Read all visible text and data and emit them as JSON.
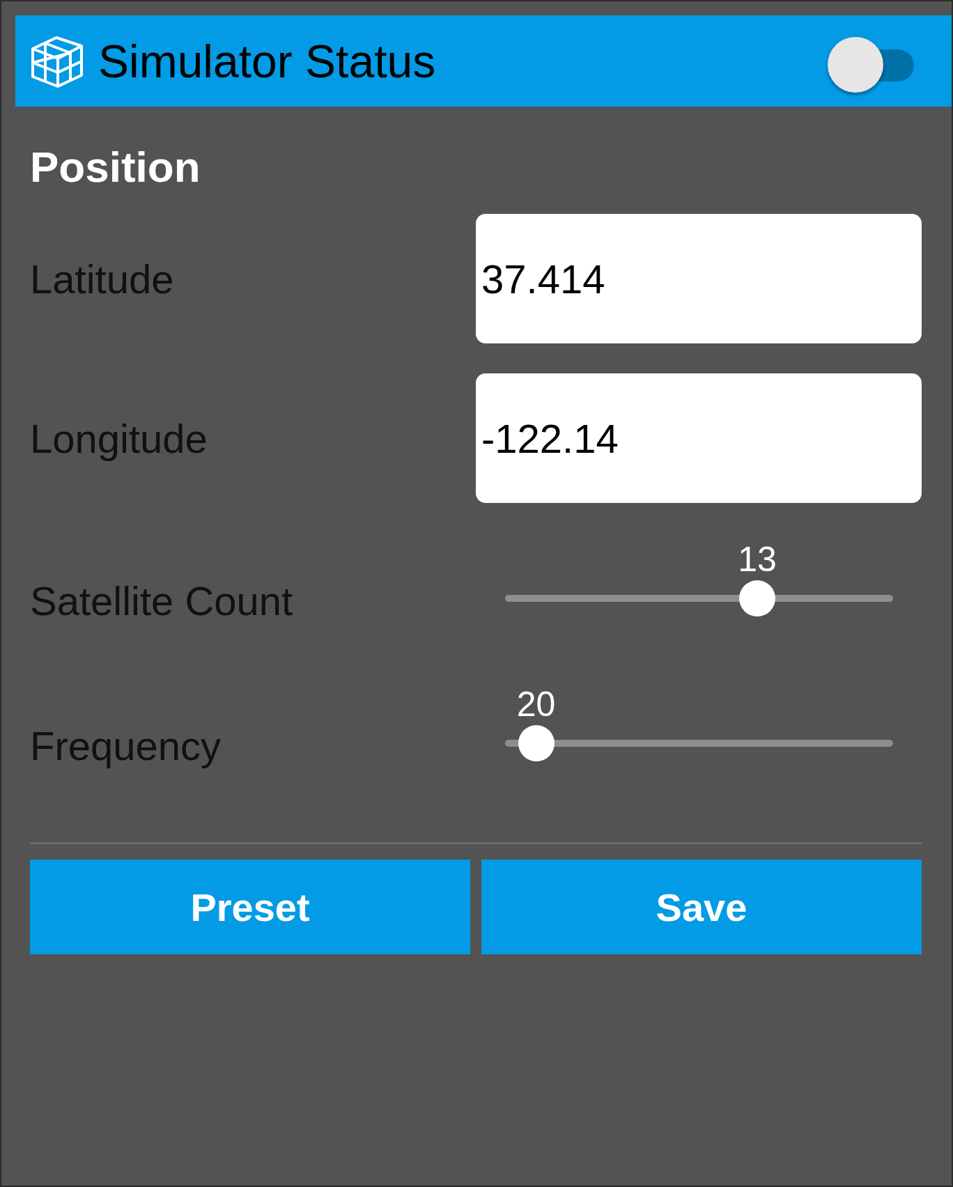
{
  "header": {
    "title": "Simulator Status",
    "toggle": {
      "on": false
    }
  },
  "section_title": "Position",
  "rows": [
    {
      "kind": "field",
      "label": "Latitude",
      "value": "37.414"
    },
    {
      "kind": "field",
      "label": "Longitude",
      "value": "-122.14"
    },
    {
      "kind": "slider",
      "label": "Satellite Count",
      "value": "13",
      "level": 0.65
    },
    {
      "kind": "slider",
      "label": "Frequency",
      "value": "20",
      "level": 0.08
    }
  ],
  "buttons": [
    {
      "label": "Preset"
    },
    {
      "label": "Save"
    }
  ]
}
